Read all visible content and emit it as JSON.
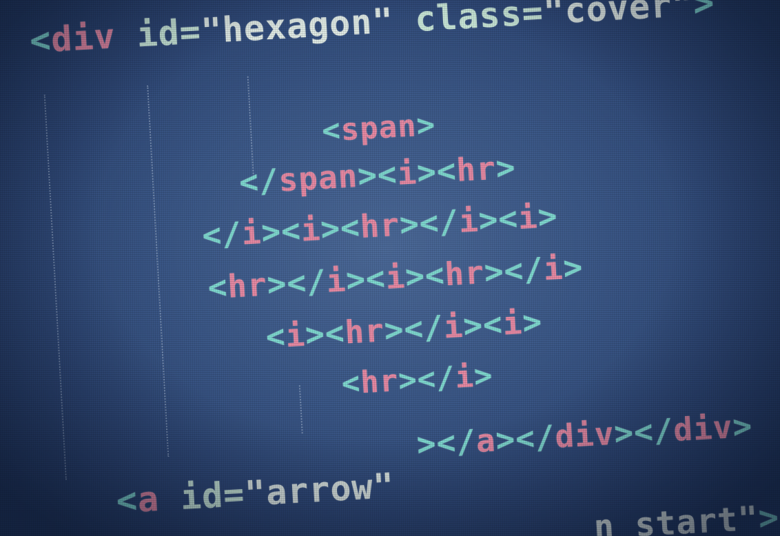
{
  "lines": {
    "l1": {
      "open": "<",
      "tag": "div",
      "attr1": " id",
      "eq1": "=",
      "str1": "\"hexagon\"",
      "attr2": " class",
      "eq2": "=",
      "str2": "\"cover\"",
      "close": ">"
    },
    "l2": {
      "open": "<",
      "tag": "span",
      "close": ">"
    },
    "l3": {
      "a": "</",
      "b": "span",
      "c": "><",
      "d": "i",
      "e": "><",
      "f": "hr",
      "g": ">"
    },
    "l4": {
      "a": "</",
      "b": "i",
      "c": "><",
      "d": "i",
      "e": "><",
      "f": "hr",
      "g": "></",
      "h": "i",
      "i": "><",
      "j": "i",
      "k": ">"
    },
    "l5": {
      "a": "<",
      "b": "hr",
      "c": "></",
      "d": "i",
      "e": "><",
      "f": "i",
      "g": "><",
      "h": "hr",
      "i": "></",
      "j": "i",
      "k": ">"
    },
    "l6": {
      "a": "<",
      "b": "i",
      "c": "><",
      "d": "hr",
      "e": "></",
      "f": "i",
      "g": "><",
      "h": "i",
      "i": ">"
    },
    "l7": {
      "a": "<",
      "b": "hr",
      "c": "></",
      "d": "i",
      "e": ">"
    },
    "l8": {
      "a": "></",
      "b": "a",
      "c": "></",
      "d": "div",
      "e": "></",
      "f": "div",
      "g": ">"
    },
    "l9": {
      "a": "<",
      "b": "a",
      "attr": " id",
      "eq": "=",
      "str": "\"arrow\""
    },
    "l10": {
      "str": "n start\"",
      "close": ">"
    }
  }
}
